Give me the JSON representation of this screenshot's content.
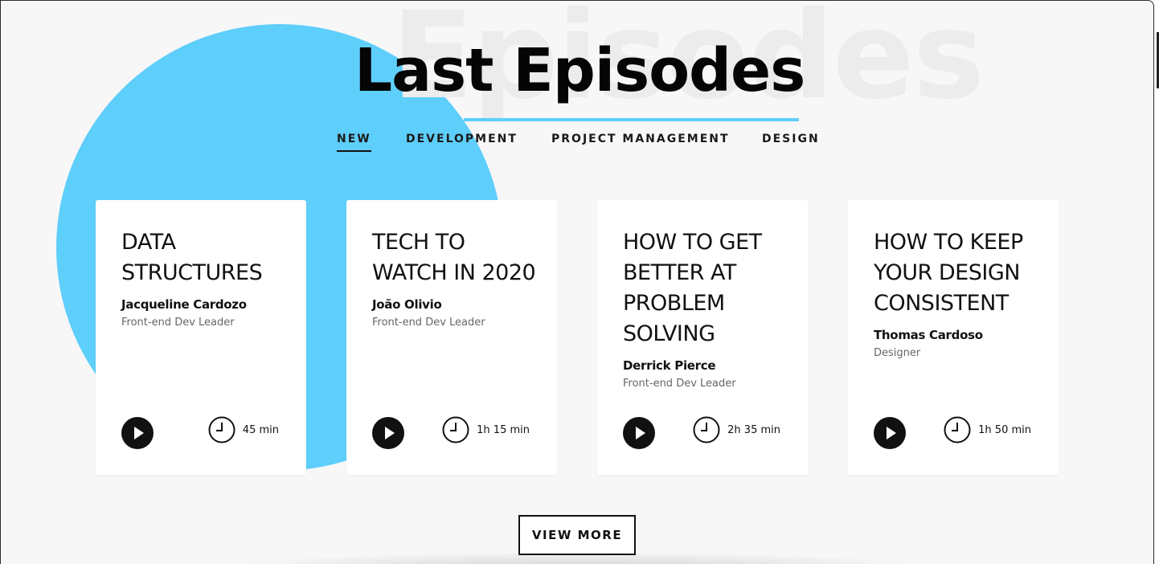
{
  "page": {
    "background_word": "Episodes",
    "title": "Last Episodes",
    "accent_color": "#5ecefb"
  },
  "tabs": [
    {
      "label": "NEW",
      "active": true
    },
    {
      "label": "DEVELOPMENT",
      "active": false
    },
    {
      "label": "PROJECT MANAGEMENT",
      "active": false
    },
    {
      "label": "DESIGN",
      "active": false
    }
  ],
  "episodes": [
    {
      "title": "DATA STRUCTURES",
      "author": "Jacqueline Cardozo",
      "role": "Front-end Dev Leader",
      "duration": "45 min",
      "play_icon": "play-icon",
      "clock_icon": "clock-icon"
    },
    {
      "title": "TECH TO WATCH IN 2020",
      "author": "João Olivio",
      "role": "Front-end Dev Leader",
      "duration": "1h 15 min",
      "play_icon": "play-icon",
      "clock_icon": "clock-icon"
    },
    {
      "title": "HOW TO GET BETTER AT PROBLEM SOLVING",
      "author": "Derrick Pierce",
      "role": "Front-end Dev Leader",
      "duration": "2h 35 min",
      "play_icon": "play-icon",
      "clock_icon": "clock-icon"
    },
    {
      "title": "HOW TO KEEP YOUR DESIGN CONSISTENT",
      "author": "Thomas Cardoso",
      "role": "Designer",
      "duration": "1h 50 min",
      "play_icon": "play-icon",
      "clock_icon": "clock-icon"
    }
  ],
  "actions": {
    "view_more_label": "VIEW MORE"
  }
}
